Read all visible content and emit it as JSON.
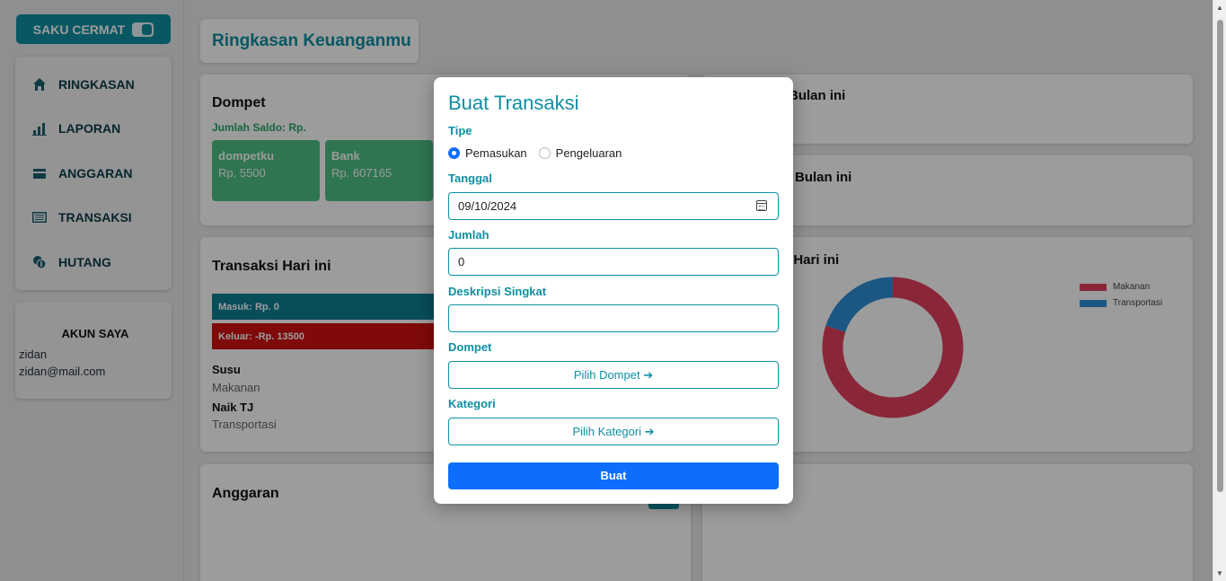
{
  "app": {
    "brand": "SAKU CERMAT"
  },
  "sidebar": {
    "items": [
      {
        "label": "RINGKASAN",
        "icon": "home-icon"
      },
      {
        "label": "LAPORAN",
        "icon": "bar-chart-icon"
      },
      {
        "label": "ANGGARAN",
        "icon": "wallet-icon"
      },
      {
        "label": "TRANSAKSI",
        "icon": "list-icon"
      },
      {
        "label": "HUTANG",
        "icon": "coins-icon"
      }
    ],
    "account": {
      "title": "AKUN SAYA",
      "name": "zidan",
      "email": "zidan@mail.com"
    }
  },
  "main": {
    "title": "Ringkasan Keuanganmu",
    "dompet": {
      "title": "Dompet",
      "saldo_label": "Jumlah Saldo: Rp.",
      "wallets": [
        {
          "name": "dompetku",
          "value": "Rp. 5500"
        },
        {
          "name": "Bank",
          "value": "Rp. 607165"
        }
      ]
    },
    "right_cards": {
      "card1_title": "Bulan ini",
      "card2_title": "Bulan ini",
      "card3_title": "n Hari ini"
    },
    "transaksi": {
      "title": "Transaksi Hari ini",
      "masuk": "Masuk: Rp. 0",
      "keluar": "Keluar: -Rp. 13500",
      "items": [
        {
          "name": "Susu",
          "category": "Makanan"
        },
        {
          "name": "Naik TJ",
          "category": "Transportasi"
        }
      ]
    },
    "anggaran": {
      "title": "Anggaran"
    }
  },
  "chart_data": {
    "type": "pie",
    "title": "",
    "categories": [
      "Makanan",
      "Transportasi"
    ],
    "values": [
      80,
      20
    ],
    "colors": [
      "#e0405e",
      "#2e8ed8"
    ],
    "legend": "top-right"
  },
  "modal": {
    "title": "Buat Transaksi",
    "type_label": "Tipe",
    "options": [
      "Pemasukan",
      "Pengeluaran"
    ],
    "selected": "Pemasukan",
    "date_label": "Tanggal",
    "date_value": "09/10/2024",
    "amount_label": "Jumlah",
    "amount_value": "0",
    "desc_label": "Deskripsi Singkat",
    "desc_value": "",
    "wallet_label": "Dompet",
    "wallet_button": "Pilih Dompet ➔",
    "category_label": "Kategori",
    "category_button": "Pilih Kategori ➔",
    "submit": "Buat"
  },
  "colors": {
    "accent": "#0e8fa3",
    "primary": "#0d6efd",
    "income": "#0e7f94",
    "expense": "#d10f0f",
    "wallet_tile": "#4dbf83"
  }
}
